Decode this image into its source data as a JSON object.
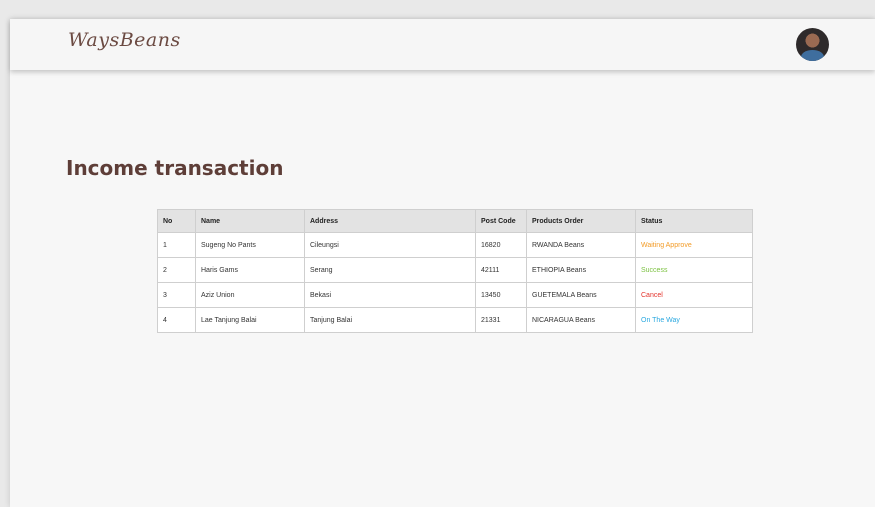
{
  "navbar": {
    "logo_text": "WaysBeans"
  },
  "page": {
    "title": "Income transaction"
  },
  "table": {
    "headers": [
      "No",
      "Name",
      "Address",
      "Post Code",
      "Products Order",
      "Status"
    ],
    "rows": [
      {
        "no": "1",
        "name": "Sugeng No Pants",
        "address": "Cileungsi",
        "post_code": "16820",
        "products": "RWANDA Beans",
        "status": "Waiting Approve",
        "status_kind": "waiting"
      },
      {
        "no": "2",
        "name": "Haris Gams",
        "address": "Serang",
        "post_code": "42111",
        "products": "ETHIOPIA Beans",
        "status": "Success",
        "status_kind": "success"
      },
      {
        "no": "3",
        "name": "Aziz Union",
        "address": "Bekasi",
        "post_code": "13450",
        "products": "GUETEMALA Beans",
        "status": "Cancel",
        "status_kind": "cancel"
      },
      {
        "no": "4",
        "name": "Lae Tanjung Balai",
        "address": "Tanjung Balai",
        "post_code": "21331",
        "products": "NICARAGUA Beans",
        "status": "On The Way",
        "status_kind": "ontheway"
      }
    ]
  },
  "colors": {
    "brand_brown": "#5e3e38",
    "status_waiting": "#f39c28",
    "status_success": "#7cc242",
    "status_cancel": "#e3322b",
    "status_ontheway": "#2aa8e0"
  }
}
